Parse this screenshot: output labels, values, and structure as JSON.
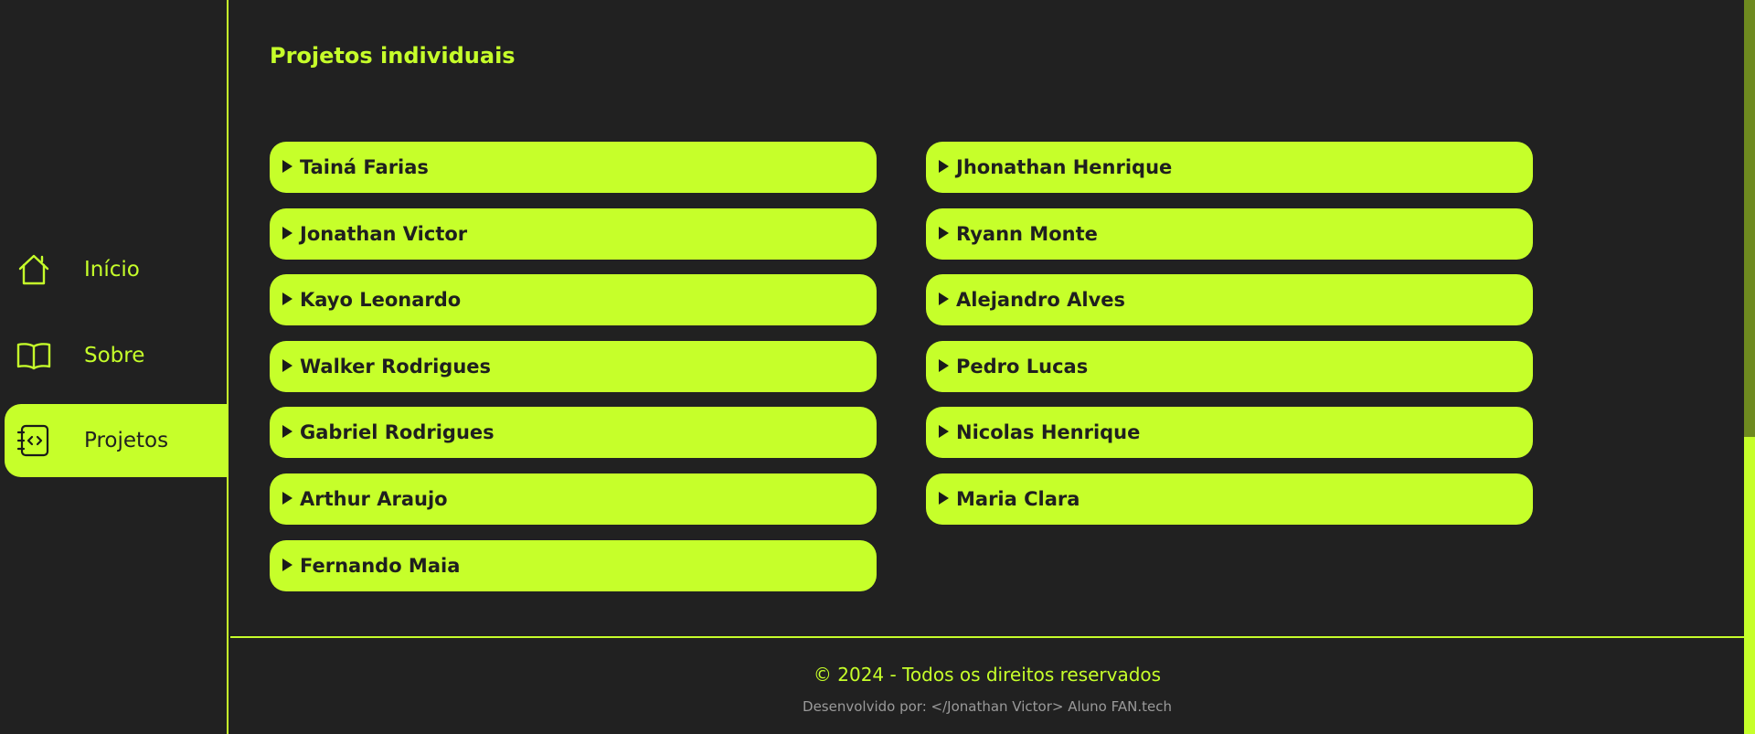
{
  "colors": {
    "accent": "#c6ff2a",
    "background": "#212121",
    "text_dark": "#1f1f1f",
    "muted": "#9a9a9a"
  },
  "sidebar": {
    "items": [
      {
        "label": "Início",
        "icon": "home-icon",
        "active": false
      },
      {
        "label": "Sobre",
        "icon": "book-icon",
        "active": false
      },
      {
        "label": "Projetos",
        "icon": "code-notebook-icon",
        "active": true
      }
    ]
  },
  "main": {
    "title": "Projetos individuais",
    "projects_left": [
      "Tainá Farias",
      "Jonathan Victor",
      "Kayo Leonardo",
      "Walker Rodrigues",
      "Gabriel Rodrigues",
      "Arthur Araujo",
      "Fernando Maia"
    ],
    "projects_right": [
      "Jhonathan Henrique",
      "Ryann Monte",
      "Alejandro Alves",
      "Pedro Lucas",
      "Nicolas Henrique",
      "Maria Clara"
    ]
  },
  "footer": {
    "copyright": "© 2024 - Todos os direitos reservados",
    "developer": "Desenvolvido por: </Jonathan Victor> Aluno FAN.tech"
  },
  "scrollbar": {
    "position_fraction": 0.0,
    "thumb_fraction": 0.6
  }
}
